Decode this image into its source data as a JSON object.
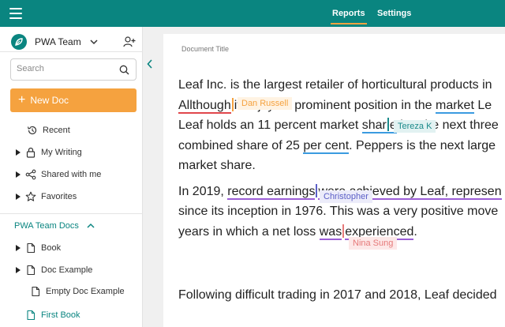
{
  "header": {
    "tabs": [
      {
        "label": "Reports",
        "active": true
      },
      {
        "label": "Settings",
        "active": false
      }
    ]
  },
  "sidebar": {
    "team_name": "PWA Team",
    "search": {
      "placeholder": "Search",
      "value": ""
    },
    "new_doc_label": "New Doc",
    "nav_items": [
      {
        "label": "Recent",
        "icon": "history-icon"
      },
      {
        "label": "My Writing",
        "icon": "lock-icon"
      },
      {
        "label": "Shared with me",
        "icon": "share-icon"
      },
      {
        "label": "Favorites",
        "icon": "star-icon"
      }
    ],
    "section_title": "PWA Team Docs",
    "docs": [
      {
        "label": "Book",
        "icon": "document-icon"
      },
      {
        "label": "Doc Example",
        "icon": "document-icon"
      },
      {
        "label": "Empty Doc Example",
        "icon": "document-icon"
      },
      {
        "label": "First Book",
        "icon": "document-icon"
      }
    ]
  },
  "document": {
    "title_placeholder": "Document Title",
    "p1": {
      "l1": "Leaf Inc. is the largest retailer of horticultural products in",
      "l2a": "Allthough",
      "l2b": "it enjoys a prominent position in the ",
      "l2c": "market",
      "l2d": " Le",
      "l3a": "Leaf holds an 11 percent market ",
      "l3b": "shar",
      "l3c": "e",
      "l3d": " but the next three",
      "l4a": "combined share of 25 ",
      "l4b": "per cent",
      "l4c": ". Peppers is the next large",
      "l5": "market share."
    },
    "p2": {
      "l1a": "In 2019, ",
      "l1b": "record earnings",
      "l1c": "were achieved by Leaf",
      "l1d": ", represen",
      "l2": "since its inception in 1976. This was a very positive move",
      "l3a": "years in which a net loss ",
      "l3b": "was",
      "l3c": "experienced",
      "l3d": "."
    },
    "p3": {
      "l1": "Following difficult trading in 2017 and 2018, Leaf decided"
    },
    "collaborators": [
      {
        "name": "Dan Russell",
        "color": "#f5a23f",
        "bg": "#fff3e3"
      },
      {
        "name": "Tereza K",
        "color": "#1b8a8a",
        "bg": "#e2f2f2"
      },
      {
        "name": "Christopher",
        "color": "#5b5fc7",
        "bg": "#ececfa"
      },
      {
        "name": "Nina Sung",
        "color": "#e67a7a",
        "bg": "#fde8e8"
      }
    ]
  },
  "colors": {
    "brand": "#0a8580",
    "accent": "#f5a23f"
  }
}
